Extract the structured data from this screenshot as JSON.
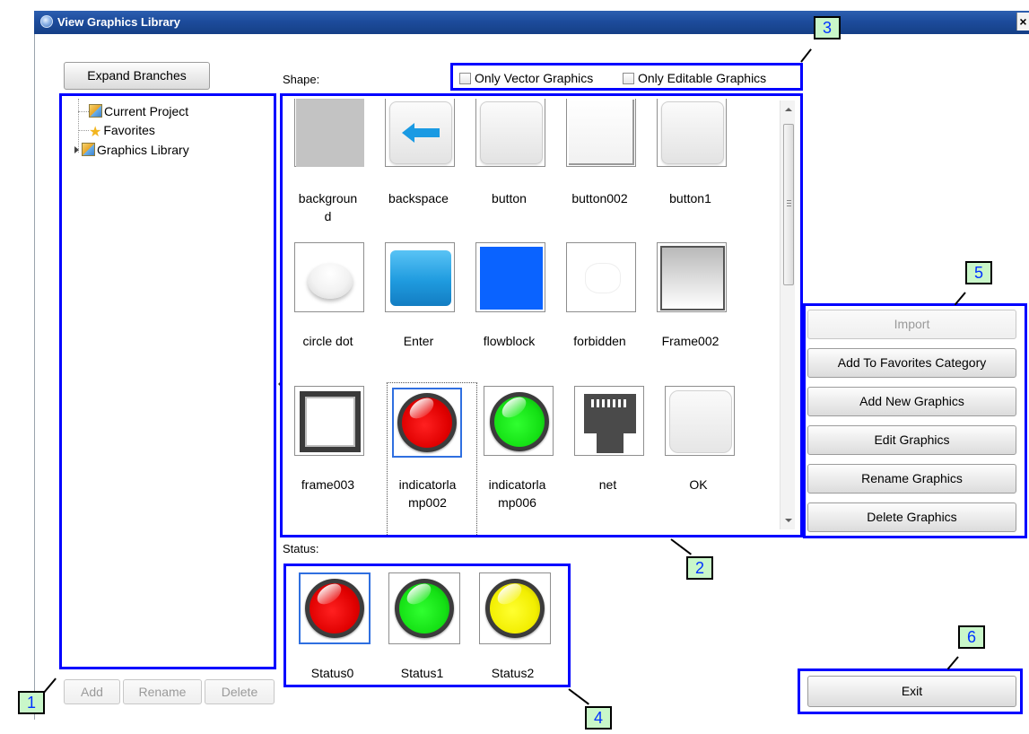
{
  "window": {
    "title": "View Graphics Library",
    "close_glyph": "×"
  },
  "tree": {
    "expand_label": "Expand Branches",
    "items": [
      {
        "label": "Current Project",
        "icon": "project-icon"
      },
      {
        "label": "Favorites",
        "icon": "star-icon"
      },
      {
        "label": "Graphics Library",
        "icon": "library-icon"
      }
    ],
    "add_label": "Add",
    "rename_label": "Rename",
    "delete_label": "Delete"
  },
  "shape": {
    "label": "Shape:",
    "only_vector": "Only Vector Graphics",
    "only_editable": "Only Editable Graphics",
    "items": [
      {
        "name": "backgroun\nd",
        "kind": "background"
      },
      {
        "name": "backspace",
        "kind": "backspace"
      },
      {
        "name": "button",
        "kind": "button"
      },
      {
        "name": "button002",
        "kind": "white"
      },
      {
        "name": "button1",
        "kind": "button"
      },
      {
        "name": "circle dot",
        "kind": "dot"
      },
      {
        "name": "Enter",
        "kind": "enter"
      },
      {
        "name": "flowblock",
        "kind": "flow"
      },
      {
        "name": "forbidden",
        "kind": "forbidden"
      },
      {
        "name": "Frame002",
        "kind": "frame002"
      },
      {
        "name": "frame003",
        "kind": "frame003"
      },
      {
        "name": "indicatorla\nmp002",
        "kind": "lamp-red",
        "selected": true
      },
      {
        "name": "indicatorla\nmp006",
        "kind": "lamp-green"
      },
      {
        "name": "net",
        "kind": "net"
      },
      {
        "name": "OK",
        "kind": "ok"
      }
    ]
  },
  "status": {
    "label": "Status:",
    "items": [
      {
        "name": "Status0",
        "color": "red",
        "selected": true
      },
      {
        "name": "Status1",
        "color": "green"
      },
      {
        "name": "Status2",
        "color": "yellow"
      }
    ]
  },
  "actions": {
    "import": "Import",
    "add_favorites": "Add To Favorites Category",
    "add_new": "Add New Graphics",
    "edit": "Edit Graphics",
    "rename": "Rename Graphics",
    "delete": "Delete Graphics",
    "exit": "Exit"
  },
  "annotations": [
    "1",
    "2",
    "3",
    "4",
    "5",
    "6"
  ],
  "colors": {
    "annotation_box": "#0000ff",
    "annotation_tag_bg": "#c9f7c9",
    "annotation_tag_text": "#0033ff",
    "selection": "#2f6fe0"
  }
}
